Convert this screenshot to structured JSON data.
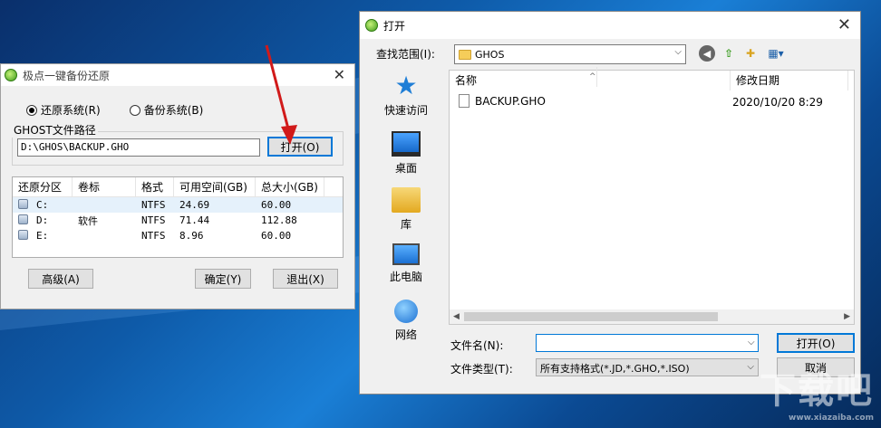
{
  "ghost": {
    "title": "极点一键备份还原",
    "radio_restore": "还原系统(R)",
    "radio_backup": "备份系统(B)",
    "group_label": "GHOST文件路径",
    "path_value": "D:\\GHOS\\BACKUP.GHO",
    "open_button": "打开(O)",
    "columns": [
      "还原分区",
      "卷标",
      "格式",
      "可用空间(GB)",
      "总大小(GB)"
    ],
    "partitions": [
      {
        "drive": "C:",
        "label": "",
        "format": "NTFS",
        "free": "24.69",
        "total": "60.00"
      },
      {
        "drive": "D:",
        "label": "软件",
        "format": "NTFS",
        "free": "71.44",
        "total": "112.88"
      },
      {
        "drive": "E:",
        "label": "",
        "format": "NTFS",
        "free": "8.96",
        "total": "60.00"
      }
    ],
    "advanced_button": "高级(A)",
    "ok_button": "确定(Y)",
    "exit_button": "退出(X)"
  },
  "open_dialog": {
    "title": "打开",
    "lookin_label": "查找范围(I):",
    "lookin_value": "GHOS",
    "places": [
      "快速访问",
      "桌面",
      "库",
      "此电脑",
      "网络"
    ],
    "col_name": "名称",
    "col_date": "修改日期",
    "file_name": "BACKUP.GHO",
    "file_date": "2020/10/20 8:29",
    "filename_label": "文件名(N):",
    "filename_value": "",
    "filetype_label": "文件类型(T):",
    "filetype_value": "所有支持格式(*.JD,*.GHO,*.ISO)",
    "open_button": "打开(O)",
    "cancel_button": "取消"
  },
  "watermark": {
    "main": "下载吧",
    "sub": "www.xiazaiba.com"
  },
  "icons": {
    "close": "close-icon",
    "back": "back-arrow-icon",
    "up": "up-folder-icon",
    "new_folder": "new-folder-icon",
    "view": "view-menu-icon"
  },
  "colors": {
    "accent": "#0078d7",
    "annotation_arrow": "#d11a1a"
  }
}
